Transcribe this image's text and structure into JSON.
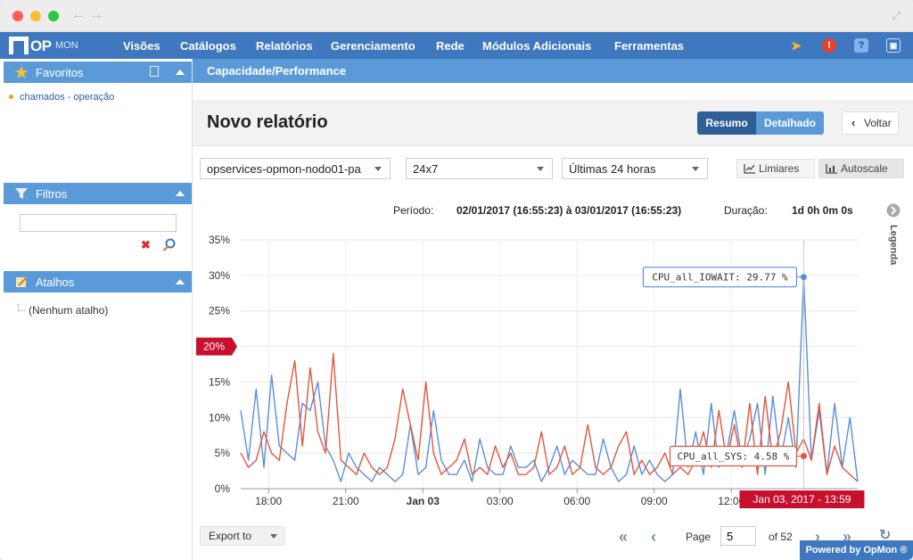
{
  "window": {
    "controls": [
      "close",
      "minimize",
      "maximize"
    ]
  },
  "nav": {
    "logo_op": "OP",
    "logo_mon": "MON",
    "items": [
      "Visões",
      "Catálogos",
      "Relatórios",
      "Gerenciamento",
      "Rede",
      "Módulos Adicionais",
      "Ferramentas"
    ]
  },
  "sidebar": {
    "favoritos": {
      "title": "Favoritos",
      "items": [
        "chamados - operação"
      ]
    },
    "filtros": {
      "title": "Filtros",
      "input_value": ""
    },
    "atalhos": {
      "title": "Atalhos",
      "items": [
        "(Nenhum atalho)"
      ]
    }
  },
  "breadcrumb": "Capacidade/Performance",
  "page_title": "Novo relatório",
  "view_toggle": {
    "resumo": "Resumo",
    "detalhado": "Detalhado",
    "selected": "Resumo"
  },
  "back_label": "Voltar",
  "selects": {
    "host": "opservices-opmon-nodo01-pa",
    "schedule": "24x7",
    "range": "Últimas 24 horas"
  },
  "toolbar": {
    "limiares": "Limiares",
    "autoscale": "Autoscale"
  },
  "period": {
    "periodo_label": "Período:",
    "periodo_value": "02/01/2017 (16:55:23) à 03/01/2017 (16:55:23)",
    "duracao_label": "Duração:",
    "duracao_value": "1d 0h 0m 0s"
  },
  "legend_tab": "Legenda",
  "colors": {
    "iowait": "#5b8ed8",
    "sys": "#e0563e",
    "threshold": "#c8102e",
    "accent": "#3f78bf"
  },
  "chart_data": {
    "type": "line",
    "y_axis": {
      "ticks": [
        "0%",
        "5%",
        "10%",
        "15%",
        "20%",
        "25%",
        "30%",
        "35%"
      ],
      "ylim": [
        0,
        35
      ],
      "unit": "%"
    },
    "x_axis": {
      "ticks": [
        "18:00",
        "21:00",
        "Jan 03",
        "03:00",
        "06:00",
        "09:00",
        "12:00"
      ],
      "bold_tick": "Jan 03",
      "xlim": [
        "2017-01-02 16:55",
        "2017-01-03 16:55"
      ]
    },
    "threshold": {
      "value": 20,
      "label": "20%"
    },
    "grid": true,
    "series": [
      {
        "name": "CPU_all_IOWAIT",
        "color": "#5b8ed8",
        "x_hours": [
          0,
          0.3,
          0.6,
          0.9,
          1.2,
          1.5,
          1.8,
          2.1,
          2.4,
          2.7,
          3.0,
          3.3,
          3.6,
          3.9,
          4.2,
          4.5,
          4.8,
          5.1,
          5.4,
          5.7,
          6.0,
          6.3,
          6.6,
          6.9,
          7.2,
          7.5,
          7.8,
          8.1,
          8.4,
          8.7,
          9.0,
          9.3,
          9.6,
          9.9,
          10.2,
          10.5,
          10.8,
          11.1,
          11.4,
          11.7,
          12.0,
          12.3,
          12.6,
          12.9,
          13.2,
          13.5,
          13.8,
          14.1,
          14.4,
          14.7,
          15.0,
          15.3,
          15.6,
          15.9,
          16.2,
          16.5,
          16.8,
          17.1,
          17.4,
          17.7,
          18.0,
          18.3,
          18.6,
          18.9,
          19.2,
          19.5,
          19.8,
          20.1,
          20.4,
          20.7,
          21.0,
          21.3,
          21.6,
          21.9,
          22.2,
          22.5,
          22.8,
          23.1,
          23.4,
          23.7,
          24.0
        ],
        "values": [
          11,
          4,
          14,
          3,
          16,
          6,
          5,
          4,
          12,
          11,
          15,
          6,
          4,
          1,
          5,
          3,
          2,
          1,
          3,
          2,
          1,
          2,
          9,
          2,
          3,
          11,
          4,
          2,
          2,
          4,
          1,
          7,
          3,
          2,
          2,
          6,
          3,
          3,
          4,
          1,
          3,
          6,
          2,
          4,
          3,
          2,
          2,
          7,
          3,
          1,
          2,
          6,
          2,
          4,
          2,
          1,
          2,
          14,
          3,
          8,
          2,
          12,
          3,
          5,
          11,
          4,
          7,
          12,
          2,
          13,
          4,
          10,
          3,
          29.77,
          4,
          11,
          2,
          12,
          3,
          10,
          1
        ]
      },
      {
        "name": "CPU_all_SYS",
        "color": "#e0563e",
        "x_hours": [
          0,
          0.3,
          0.6,
          0.9,
          1.2,
          1.5,
          1.8,
          2.1,
          2.4,
          2.7,
          3.0,
          3.3,
          3.6,
          3.9,
          4.2,
          4.5,
          4.8,
          5.1,
          5.4,
          5.7,
          6.0,
          6.3,
          6.6,
          6.9,
          7.2,
          7.5,
          7.8,
          8.1,
          8.4,
          8.7,
          9.0,
          9.3,
          9.6,
          9.9,
          10.2,
          10.5,
          10.8,
          11.1,
          11.4,
          11.7,
          12.0,
          12.3,
          12.6,
          12.9,
          13.2,
          13.5,
          13.8,
          14.1,
          14.4,
          14.7,
          15.0,
          15.3,
          15.6,
          15.9,
          16.2,
          16.5,
          16.8,
          17.1,
          17.4,
          17.7,
          18.0,
          18.3,
          18.6,
          18.9,
          19.2,
          19.5,
          19.8,
          20.1,
          20.4,
          20.7,
          21.0,
          21.3,
          21.6,
          21.9,
          22.2,
          22.5,
          22.8,
          23.1,
          23.4,
          23.7,
          24.0
        ],
        "values": [
          5,
          3,
          4,
          8,
          5,
          4,
          12,
          18,
          6,
          17,
          8,
          5,
          19,
          4,
          3,
          2,
          5,
          3,
          2,
          3,
          7,
          14,
          9,
          4,
          15,
          5,
          2,
          3,
          4,
          7,
          2,
          3,
          2,
          6,
          3,
          5,
          2,
          2,
          3,
          8,
          2,
          3,
          6,
          2,
          3,
          9,
          3,
          2,
          3,
          6,
          8,
          2,
          4,
          2,
          3,
          5,
          2,
          3,
          2,
          4,
          8,
          3,
          11,
          4,
          9,
          3,
          12,
          2,
          13,
          4,
          8,
          15,
          5,
          7,
          4,
          12,
          2,
          6,
          3,
          2,
          1
        ]
      }
    ],
    "tooltips": [
      {
        "label": "CPU_all_IOWAIT: 29.77 %"
      },
      {
        "label": "CPU_all_SYS: 4.58 %"
      }
    ],
    "crosshair_label": "Jan 03, 2017 - 13:59"
  },
  "footer": {
    "export_label": "Export to",
    "page_label": "Page",
    "page_value": "5",
    "page_total": "of 52",
    "powered": "Powered by OpMon ®"
  }
}
